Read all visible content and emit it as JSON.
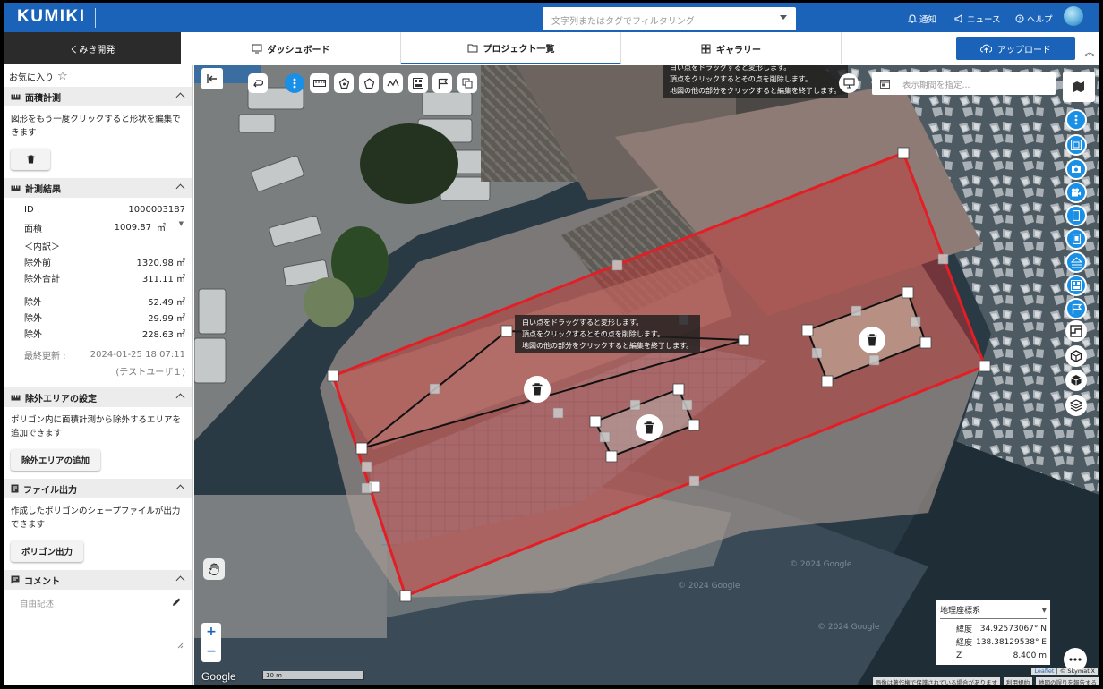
{
  "header": {
    "logo": "KUMIKI",
    "search_placeholder": "文字列またはタグでフィルタリング",
    "links": {
      "notice": "通知",
      "news": "ニュース",
      "help": "ヘルプ"
    }
  },
  "nav": {
    "brand": "くみき開発",
    "tabs": [
      {
        "label": "ダッシュボード"
      },
      {
        "label": "プロジェクト一覧"
      },
      {
        "label": "ギャラリー"
      }
    ],
    "upload": "アップロード"
  },
  "sidebar": {
    "favorite": "お気に入り",
    "area_section": {
      "title": "面積計測",
      "desc": "図形をもう一度クリックすると形状を編集できます"
    },
    "result": {
      "title": "計測結果",
      "id_label": "ID :",
      "id_value": "1000003187",
      "area_label": "面積",
      "area_value": "1009.87",
      "area_unit": "㎡",
      "breakdown_label": "＜内訳＞",
      "rows": [
        {
          "label": "除外前",
          "value": "1320.98 ㎡"
        },
        {
          "label": "除外合計",
          "value": "311.11 ㎡"
        },
        {
          "label": "除外",
          "value": "52.49 ㎡"
        },
        {
          "label": "除外",
          "value": "29.99 ㎡"
        },
        {
          "label": "除外",
          "value": "228.63 ㎡"
        }
      ],
      "updated_label": "最終更新 :",
      "updated_value": "2024-01-25 18:07:11",
      "updated_user": "(テストユーザ１)"
    },
    "exclude_section": {
      "title": "除外エリアの設定",
      "desc": "ポリゴン内に面積計測から除外するエリアを追加できます",
      "button": "除外エリアの追加"
    },
    "file_section": {
      "title": "ファイル出力",
      "desc": "作成したポリゴンのシェープファイルが出力できます",
      "button": "ポリゴン出力"
    },
    "comment_section": {
      "title": "コメント",
      "placeholder": "自由記述"
    }
  },
  "map": {
    "tooltip_top": [
      "白い点をドラッグすると変形します。",
      "頂点をクリックするとその点を削除します。",
      "地図の他の部分をクリックすると編集を終了します。"
    ],
    "tooltip_mid": [
      "白い点をドラッグすると変形します。",
      "頂点をクリックするとその点を削除します。",
      "地図の他の部分をクリックすると編集を終了します。"
    ],
    "date_placeholder": "表示期間を指定...",
    "coords": {
      "system": "地理座標系",
      "lat_label": "緯度",
      "lat": "34.92573067° N",
      "lon_label": "経度",
      "lon": "138.38129538° E",
      "z_label": "Z",
      "z": "8.400 m"
    },
    "scale": "10 m",
    "google": "Google",
    "watermarks": [
      "© 2024 Google",
      "© 2024 Google",
      "© 2024 Google"
    ],
    "attribution": {
      "leaflet": "Leaflet",
      "sep": "| © SkymatiX",
      "notice": "画像は著作権で保護されている場合があります",
      "terms": "利用規約",
      "report": "地図の誤りを報告する"
    },
    "zoom_in": "+",
    "zoom_out": "−",
    "accent": "#1a8fe6",
    "polygon_color": "#e31e24"
  }
}
